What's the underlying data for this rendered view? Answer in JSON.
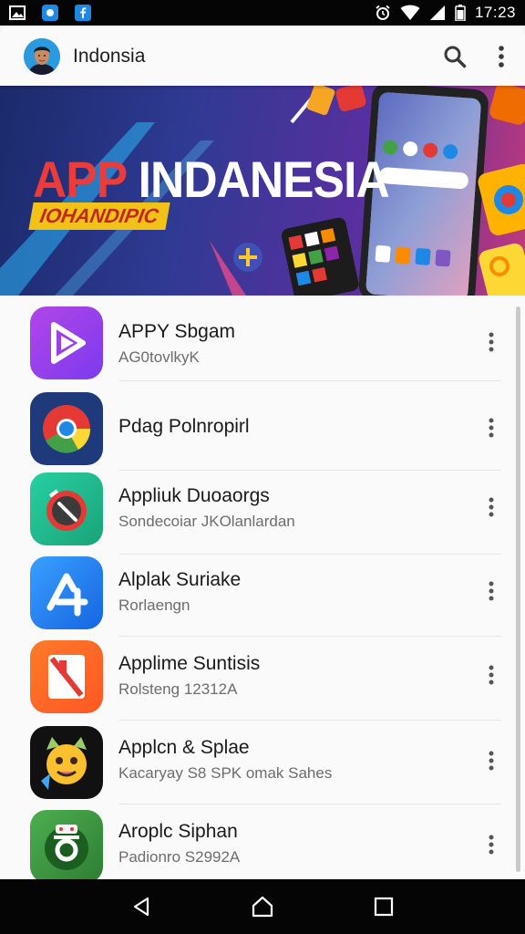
{
  "status_bar": {
    "time": "17:23",
    "left_icons": [
      "gallery-icon",
      "app-notification-icon",
      "facebook-icon"
    ],
    "right_icons": [
      "alarm-icon",
      "wifi-icon",
      "signal-icon",
      "battery-icon"
    ]
  },
  "app_bar": {
    "title": "Indonsia",
    "actions": [
      "search-icon",
      "more-vert-icon"
    ]
  },
  "banner": {
    "title_part1": "APP",
    "title_part2": "INDANESIA",
    "subtitle": "IOHANDIPIC"
  },
  "apps": [
    {
      "title": "APPY Sbgam",
      "subtitle": "AG0tovlkyK",
      "icon": "purple-play-icon"
    },
    {
      "title": "Pdag Polnropirl",
      "subtitle": "",
      "icon": "chrome-icon"
    },
    {
      "title": "Appliuk Duoaorgs",
      "subtitle": "Sondecoiar JKOlanlardan",
      "icon": "clock-icon"
    },
    {
      "title": "Alplak Suriake",
      "subtitle": "Rorlaengn",
      "icon": "app-store-icon"
    },
    {
      "title": "Applime Suntisis",
      "subtitle": "Rolsteng 12312A",
      "icon": "bookmark-icon"
    },
    {
      "title": "Applcn & Splae",
      "subtitle": "Kacaryay S8 SPK omak Sahes",
      "icon": "cat-emoji-icon"
    },
    {
      "title": "Aroplc Siphan",
      "subtitle": "Padionro S2992A",
      "icon": "green-game-icon"
    }
  ],
  "nav_bar": {
    "buttons": [
      "back-icon",
      "home-icon",
      "recents-icon"
    ]
  },
  "colors": {
    "status_bar": "#050505",
    "app_bar": "#fafafa",
    "banner_red": "#ec3b3b",
    "banner_yellow": "#f2c216"
  }
}
